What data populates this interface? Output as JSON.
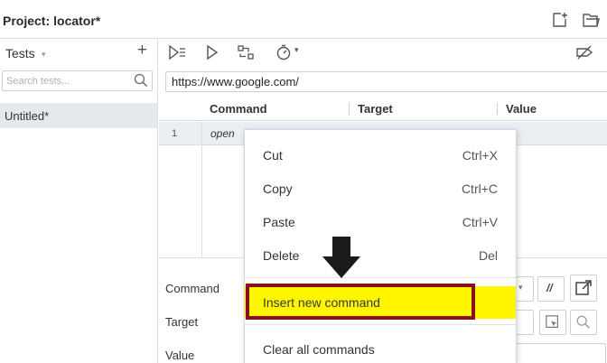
{
  "header": {
    "project_label": "Project:",
    "project_name": "locator*"
  },
  "sidebar": {
    "tests_label": "Tests",
    "caret": "▾",
    "add": "+",
    "search_placeholder": "Search tests...",
    "tests": [
      {
        "label": "Untitled*"
      }
    ]
  },
  "toolbar": {
    "speed_caret": "▾"
  },
  "url": "https://www.google.com/",
  "grid": {
    "columns": [
      "Command",
      "Target",
      "Value"
    ],
    "rows": [
      {
        "num": "1",
        "command": "open"
      }
    ]
  },
  "editor": {
    "command_label": "Command",
    "target_label": "Target",
    "value_label": "Value",
    "comment_symbol": "//"
  },
  "context_menu": {
    "items": [
      {
        "label": "Cut",
        "shortcut": "Ctrl+X"
      },
      {
        "label": "Copy",
        "shortcut": "Ctrl+C"
      },
      {
        "label": "Paste",
        "shortcut": "Ctrl+V"
      },
      {
        "label": "Delete",
        "shortcut": "Del"
      },
      {
        "label": "Insert new command",
        "shortcut": ""
      },
      {
        "label": "Clear all commands",
        "shortcut": ""
      }
    ],
    "highlight_color": "#fff600",
    "highlight_border_color": "#8b0f1a"
  },
  "icons": {
    "new_project": "new-project-icon",
    "open_project": "folder-open-icon",
    "run_all": "run-all-icon",
    "run": "play-icon",
    "step": "step-icon",
    "speed": "stopwatch-icon",
    "disable_breakpoints": "disable-breakpoints-icon",
    "search": "search-icon"
  }
}
